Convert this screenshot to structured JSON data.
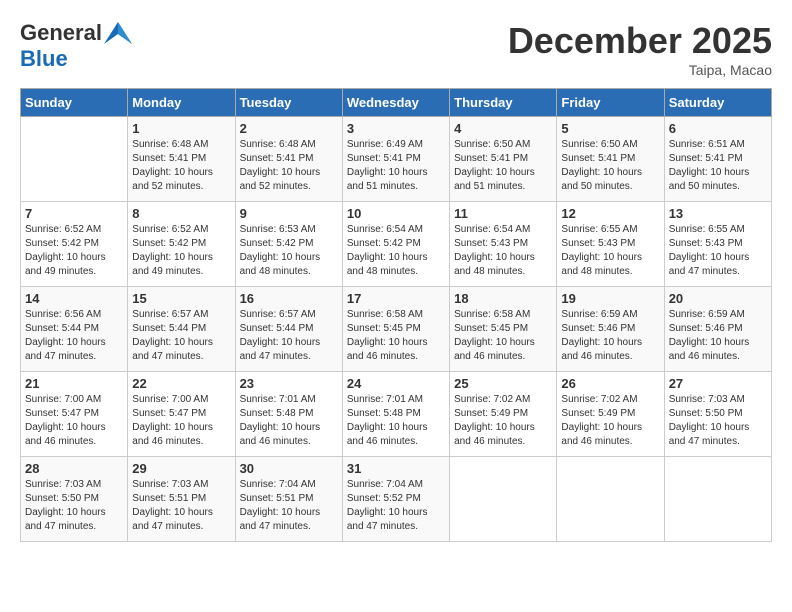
{
  "header": {
    "logo_general": "General",
    "logo_blue": "Blue",
    "title": "December 2025",
    "location": "Taipa, Macao"
  },
  "days_of_week": [
    "Sunday",
    "Monday",
    "Tuesday",
    "Wednesday",
    "Thursday",
    "Friday",
    "Saturday"
  ],
  "weeks": [
    [
      {
        "day": "",
        "info": ""
      },
      {
        "day": "1",
        "info": "Sunrise: 6:48 AM\nSunset: 5:41 PM\nDaylight: 10 hours\nand 52 minutes."
      },
      {
        "day": "2",
        "info": "Sunrise: 6:48 AM\nSunset: 5:41 PM\nDaylight: 10 hours\nand 52 minutes."
      },
      {
        "day": "3",
        "info": "Sunrise: 6:49 AM\nSunset: 5:41 PM\nDaylight: 10 hours\nand 51 minutes."
      },
      {
        "day": "4",
        "info": "Sunrise: 6:50 AM\nSunset: 5:41 PM\nDaylight: 10 hours\nand 51 minutes."
      },
      {
        "day": "5",
        "info": "Sunrise: 6:50 AM\nSunset: 5:41 PM\nDaylight: 10 hours\nand 50 minutes."
      },
      {
        "day": "6",
        "info": "Sunrise: 6:51 AM\nSunset: 5:41 PM\nDaylight: 10 hours\nand 50 minutes."
      }
    ],
    [
      {
        "day": "7",
        "info": "Sunrise: 6:52 AM\nSunset: 5:42 PM\nDaylight: 10 hours\nand 49 minutes."
      },
      {
        "day": "8",
        "info": "Sunrise: 6:52 AM\nSunset: 5:42 PM\nDaylight: 10 hours\nand 49 minutes."
      },
      {
        "day": "9",
        "info": "Sunrise: 6:53 AM\nSunset: 5:42 PM\nDaylight: 10 hours\nand 48 minutes."
      },
      {
        "day": "10",
        "info": "Sunrise: 6:54 AM\nSunset: 5:42 PM\nDaylight: 10 hours\nand 48 minutes."
      },
      {
        "day": "11",
        "info": "Sunrise: 6:54 AM\nSunset: 5:43 PM\nDaylight: 10 hours\nand 48 minutes."
      },
      {
        "day": "12",
        "info": "Sunrise: 6:55 AM\nSunset: 5:43 PM\nDaylight: 10 hours\nand 48 minutes."
      },
      {
        "day": "13",
        "info": "Sunrise: 6:55 AM\nSunset: 5:43 PM\nDaylight: 10 hours\nand 47 minutes."
      }
    ],
    [
      {
        "day": "14",
        "info": "Sunrise: 6:56 AM\nSunset: 5:44 PM\nDaylight: 10 hours\nand 47 minutes."
      },
      {
        "day": "15",
        "info": "Sunrise: 6:57 AM\nSunset: 5:44 PM\nDaylight: 10 hours\nand 47 minutes."
      },
      {
        "day": "16",
        "info": "Sunrise: 6:57 AM\nSunset: 5:44 PM\nDaylight: 10 hours\nand 47 minutes."
      },
      {
        "day": "17",
        "info": "Sunrise: 6:58 AM\nSunset: 5:45 PM\nDaylight: 10 hours\nand 46 minutes."
      },
      {
        "day": "18",
        "info": "Sunrise: 6:58 AM\nSunset: 5:45 PM\nDaylight: 10 hours\nand 46 minutes."
      },
      {
        "day": "19",
        "info": "Sunrise: 6:59 AM\nSunset: 5:46 PM\nDaylight: 10 hours\nand 46 minutes."
      },
      {
        "day": "20",
        "info": "Sunrise: 6:59 AM\nSunset: 5:46 PM\nDaylight: 10 hours\nand 46 minutes."
      }
    ],
    [
      {
        "day": "21",
        "info": "Sunrise: 7:00 AM\nSunset: 5:47 PM\nDaylight: 10 hours\nand 46 minutes."
      },
      {
        "day": "22",
        "info": "Sunrise: 7:00 AM\nSunset: 5:47 PM\nDaylight: 10 hours\nand 46 minutes."
      },
      {
        "day": "23",
        "info": "Sunrise: 7:01 AM\nSunset: 5:48 PM\nDaylight: 10 hours\nand 46 minutes."
      },
      {
        "day": "24",
        "info": "Sunrise: 7:01 AM\nSunset: 5:48 PM\nDaylight: 10 hours\nand 46 minutes."
      },
      {
        "day": "25",
        "info": "Sunrise: 7:02 AM\nSunset: 5:49 PM\nDaylight: 10 hours\nand 46 minutes."
      },
      {
        "day": "26",
        "info": "Sunrise: 7:02 AM\nSunset: 5:49 PM\nDaylight: 10 hours\nand 46 minutes."
      },
      {
        "day": "27",
        "info": "Sunrise: 7:03 AM\nSunset: 5:50 PM\nDaylight: 10 hours\nand 47 minutes."
      }
    ],
    [
      {
        "day": "28",
        "info": "Sunrise: 7:03 AM\nSunset: 5:50 PM\nDaylight: 10 hours\nand 47 minutes."
      },
      {
        "day": "29",
        "info": "Sunrise: 7:03 AM\nSunset: 5:51 PM\nDaylight: 10 hours\nand 47 minutes."
      },
      {
        "day": "30",
        "info": "Sunrise: 7:04 AM\nSunset: 5:51 PM\nDaylight: 10 hours\nand 47 minutes."
      },
      {
        "day": "31",
        "info": "Sunrise: 7:04 AM\nSunset: 5:52 PM\nDaylight: 10 hours\nand 47 minutes."
      },
      {
        "day": "",
        "info": ""
      },
      {
        "day": "",
        "info": ""
      },
      {
        "day": "",
        "info": ""
      }
    ]
  ]
}
